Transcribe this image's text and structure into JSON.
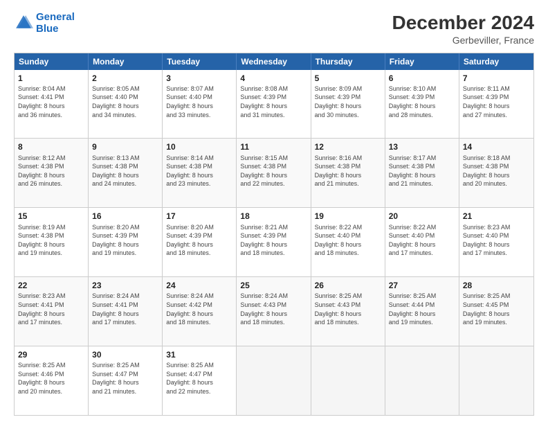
{
  "logo": {
    "line1": "General",
    "line2": "Blue"
  },
  "title": "December 2024",
  "subtitle": "Gerbeviller, France",
  "days_header": [
    "Sunday",
    "Monday",
    "Tuesday",
    "Wednesday",
    "Thursday",
    "Friday",
    "Saturday"
  ],
  "weeks": [
    [
      {
        "day": "1",
        "info": "Sunrise: 8:04 AM\nSunset: 4:41 PM\nDaylight: 8 hours\nand 36 minutes."
      },
      {
        "day": "2",
        "info": "Sunrise: 8:05 AM\nSunset: 4:40 PM\nDaylight: 8 hours\nand 34 minutes."
      },
      {
        "day": "3",
        "info": "Sunrise: 8:07 AM\nSunset: 4:40 PM\nDaylight: 8 hours\nand 33 minutes."
      },
      {
        "day": "4",
        "info": "Sunrise: 8:08 AM\nSunset: 4:39 PM\nDaylight: 8 hours\nand 31 minutes."
      },
      {
        "day": "5",
        "info": "Sunrise: 8:09 AM\nSunset: 4:39 PM\nDaylight: 8 hours\nand 30 minutes."
      },
      {
        "day": "6",
        "info": "Sunrise: 8:10 AM\nSunset: 4:39 PM\nDaylight: 8 hours\nand 28 minutes."
      },
      {
        "day": "7",
        "info": "Sunrise: 8:11 AM\nSunset: 4:39 PM\nDaylight: 8 hours\nand 27 minutes."
      }
    ],
    [
      {
        "day": "8",
        "info": "Sunrise: 8:12 AM\nSunset: 4:38 PM\nDaylight: 8 hours\nand 26 minutes."
      },
      {
        "day": "9",
        "info": "Sunrise: 8:13 AM\nSunset: 4:38 PM\nDaylight: 8 hours\nand 24 minutes."
      },
      {
        "day": "10",
        "info": "Sunrise: 8:14 AM\nSunset: 4:38 PM\nDaylight: 8 hours\nand 23 minutes."
      },
      {
        "day": "11",
        "info": "Sunrise: 8:15 AM\nSunset: 4:38 PM\nDaylight: 8 hours\nand 22 minutes."
      },
      {
        "day": "12",
        "info": "Sunrise: 8:16 AM\nSunset: 4:38 PM\nDaylight: 8 hours\nand 21 minutes."
      },
      {
        "day": "13",
        "info": "Sunrise: 8:17 AM\nSunset: 4:38 PM\nDaylight: 8 hours\nand 21 minutes."
      },
      {
        "day": "14",
        "info": "Sunrise: 8:18 AM\nSunset: 4:38 PM\nDaylight: 8 hours\nand 20 minutes."
      }
    ],
    [
      {
        "day": "15",
        "info": "Sunrise: 8:19 AM\nSunset: 4:38 PM\nDaylight: 8 hours\nand 19 minutes."
      },
      {
        "day": "16",
        "info": "Sunrise: 8:20 AM\nSunset: 4:39 PM\nDaylight: 8 hours\nand 19 minutes."
      },
      {
        "day": "17",
        "info": "Sunrise: 8:20 AM\nSunset: 4:39 PM\nDaylight: 8 hours\nand 18 minutes."
      },
      {
        "day": "18",
        "info": "Sunrise: 8:21 AM\nSunset: 4:39 PM\nDaylight: 8 hours\nand 18 minutes."
      },
      {
        "day": "19",
        "info": "Sunrise: 8:22 AM\nSunset: 4:40 PM\nDaylight: 8 hours\nand 18 minutes."
      },
      {
        "day": "20",
        "info": "Sunrise: 8:22 AM\nSunset: 4:40 PM\nDaylight: 8 hours\nand 17 minutes."
      },
      {
        "day": "21",
        "info": "Sunrise: 8:23 AM\nSunset: 4:40 PM\nDaylight: 8 hours\nand 17 minutes."
      }
    ],
    [
      {
        "day": "22",
        "info": "Sunrise: 8:23 AM\nSunset: 4:41 PM\nDaylight: 8 hours\nand 17 minutes."
      },
      {
        "day": "23",
        "info": "Sunrise: 8:24 AM\nSunset: 4:41 PM\nDaylight: 8 hours\nand 17 minutes."
      },
      {
        "day": "24",
        "info": "Sunrise: 8:24 AM\nSunset: 4:42 PM\nDaylight: 8 hours\nand 18 minutes."
      },
      {
        "day": "25",
        "info": "Sunrise: 8:24 AM\nSunset: 4:43 PM\nDaylight: 8 hours\nand 18 minutes."
      },
      {
        "day": "26",
        "info": "Sunrise: 8:25 AM\nSunset: 4:43 PM\nDaylight: 8 hours\nand 18 minutes."
      },
      {
        "day": "27",
        "info": "Sunrise: 8:25 AM\nSunset: 4:44 PM\nDaylight: 8 hours\nand 19 minutes."
      },
      {
        "day": "28",
        "info": "Sunrise: 8:25 AM\nSunset: 4:45 PM\nDaylight: 8 hours\nand 19 minutes."
      }
    ],
    [
      {
        "day": "29",
        "info": "Sunrise: 8:25 AM\nSunset: 4:46 PM\nDaylight: 8 hours\nand 20 minutes."
      },
      {
        "day": "30",
        "info": "Sunrise: 8:25 AM\nSunset: 4:47 PM\nDaylight: 8 hours\nand 21 minutes."
      },
      {
        "day": "31",
        "info": "Sunrise: 8:25 AM\nSunset: 4:47 PM\nDaylight: 8 hours\nand 22 minutes."
      },
      {
        "day": "",
        "info": ""
      },
      {
        "day": "",
        "info": ""
      },
      {
        "day": "",
        "info": ""
      },
      {
        "day": "",
        "info": ""
      }
    ]
  ]
}
